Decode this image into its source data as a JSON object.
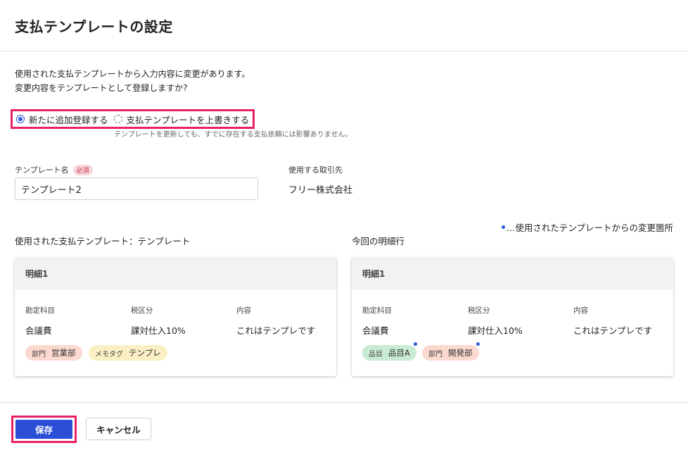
{
  "dialog": {
    "title": "支払テンプレートの設定",
    "description_line1": "使用された支払テンプレートから入力内容に変更があります。",
    "description_line2": "変更内容をテンプレートとして登録しますか?"
  },
  "register_mode": {
    "options": [
      {
        "label": "新たに追加登録する",
        "selected": true
      },
      {
        "label": "支払テンプレートを上書きする",
        "selected": false
      }
    ],
    "note": "テンプレートを更新しても、すでに存在する支払依頼には影響ありません。"
  },
  "template_name": {
    "label": "テンプレート名",
    "required_badge": "必須",
    "value": "テンプレート2"
  },
  "vendor": {
    "label": "使用する取引先",
    "value": "フリー株式会社"
  },
  "legend_text": "…使用されたテンプレートからの変更箇所",
  "accent_colors": {
    "primary": "#2a4ed6",
    "highlight": "#e6216a",
    "change_marker": "#2a57d6"
  },
  "used_template": {
    "heading": "使用された支払テンプレート：テンプレート",
    "card_title": "明細1",
    "columns": [
      {
        "header": "勘定科目",
        "value": "会議費"
      },
      {
        "header": "税区分",
        "value": "課対仕入10%"
      },
      {
        "header": "内容",
        "value": "これはテンプレです"
      }
    ],
    "tags": [
      {
        "key": "部門",
        "value": "営業部",
        "color": "#fbd9cf"
      },
      {
        "key": "メモタグ",
        "value": "テンプレ",
        "color": "#fbefc4"
      }
    ]
  },
  "current_line": {
    "heading": "今回の明細行",
    "card_title": "明細1",
    "columns": [
      {
        "header": "勘定科目",
        "value": "会議費"
      },
      {
        "header": "税区分",
        "value": "課対仕入10%"
      },
      {
        "header": "内容",
        "value": "これはテンプレです"
      }
    ],
    "tags": [
      {
        "key": "品目",
        "value": "品目A",
        "color": "#c9ebd4",
        "changed": true
      },
      {
        "key": "部門",
        "value": "開発部",
        "color": "#fbd9cf",
        "changed": true
      }
    ]
  },
  "footer": {
    "save_label": "保存",
    "cancel_label": "キャンセル"
  }
}
